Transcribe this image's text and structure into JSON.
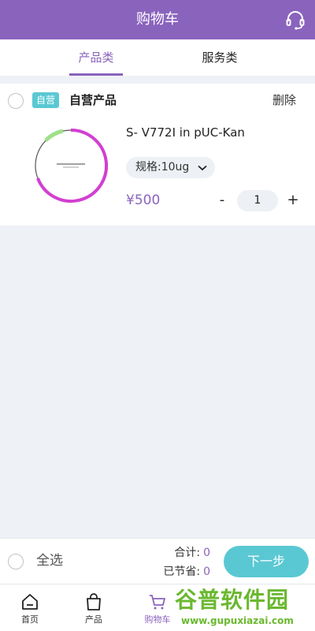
{
  "header": {
    "title": "购物车",
    "support_icon": "headset-icon"
  },
  "tabs": [
    {
      "label": "产品类",
      "active": true
    },
    {
      "label": "服务类",
      "active": false
    }
  ],
  "cart": {
    "shop_badge": "自营",
    "shop_name": "自营产品",
    "delete_label": "删除",
    "item": {
      "name": "S- V772I in pUC-Kan",
      "spec": "规格:10ug",
      "price": "¥500",
      "qty_minus": "-",
      "quantity": "1",
      "qty_plus": "+"
    }
  },
  "checkout": {
    "select_all_label": "全选",
    "total_label": "合计:",
    "total_value": "0",
    "saved_label": "已节省:",
    "saved_value": "0",
    "next_label": "下一步"
  },
  "tabbar": [
    {
      "label": "首页",
      "icon": "home-icon"
    },
    {
      "label": "产品",
      "icon": "bag-icon"
    },
    {
      "label": "购物车",
      "icon": "cart-icon",
      "active": true
    }
  ],
  "watermark": {
    "title": "谷普软件园",
    "url": "www.gupuxiazai.com"
  },
  "colors": {
    "brand": "#8a63bd",
    "accent": "#5ac8d3",
    "plasmid_arc": "#d23fd1",
    "plasmid_feature": "#9fe08a"
  }
}
